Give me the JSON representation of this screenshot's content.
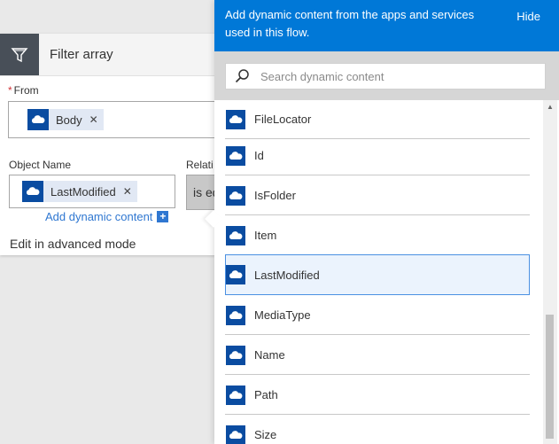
{
  "card": {
    "title": "Filter array",
    "from_label": "From",
    "from_token": "Body",
    "object_name_label": "Object Name",
    "object_token": "LastModified",
    "relation_label": "Relati",
    "operator_text": "is eq",
    "add_dynamic_label": "Add dynamic content",
    "advanced_mode_label": "Edit in advanced mode"
  },
  "panel": {
    "description": "Add dynamic content from the apps and services used in this flow.",
    "hide_label": "Hide",
    "search_placeholder": "Search dynamic content",
    "items": [
      {
        "label": "FileLocator",
        "icon": "onedrive-cloud-icon"
      },
      {
        "label": "Id",
        "icon": "onedrive-cloud-icon"
      },
      {
        "label": "IsFolder",
        "icon": "onedrive-cloud-icon"
      },
      {
        "label": "Item",
        "icon": "onedrive-cloud-icon"
      },
      {
        "label": "LastModified",
        "icon": "onedrive-cloud-icon",
        "selected": true
      },
      {
        "label": "MediaType",
        "icon": "onedrive-cloud-icon"
      },
      {
        "label": "Name",
        "icon": "onedrive-cloud-icon"
      },
      {
        "label": "Path",
        "icon": "onedrive-cloud-icon"
      },
      {
        "label": "Size",
        "icon": "onedrive-cloud-icon"
      }
    ]
  },
  "colors": {
    "accent": "#0078d7",
    "token_icon": "#0a4ca1",
    "link": "#2f77d1",
    "required": "#d13438",
    "card_icon_bg": "#484f58",
    "selected_bg": "#ebf3fd",
    "selected_border": "#4a90e2"
  }
}
